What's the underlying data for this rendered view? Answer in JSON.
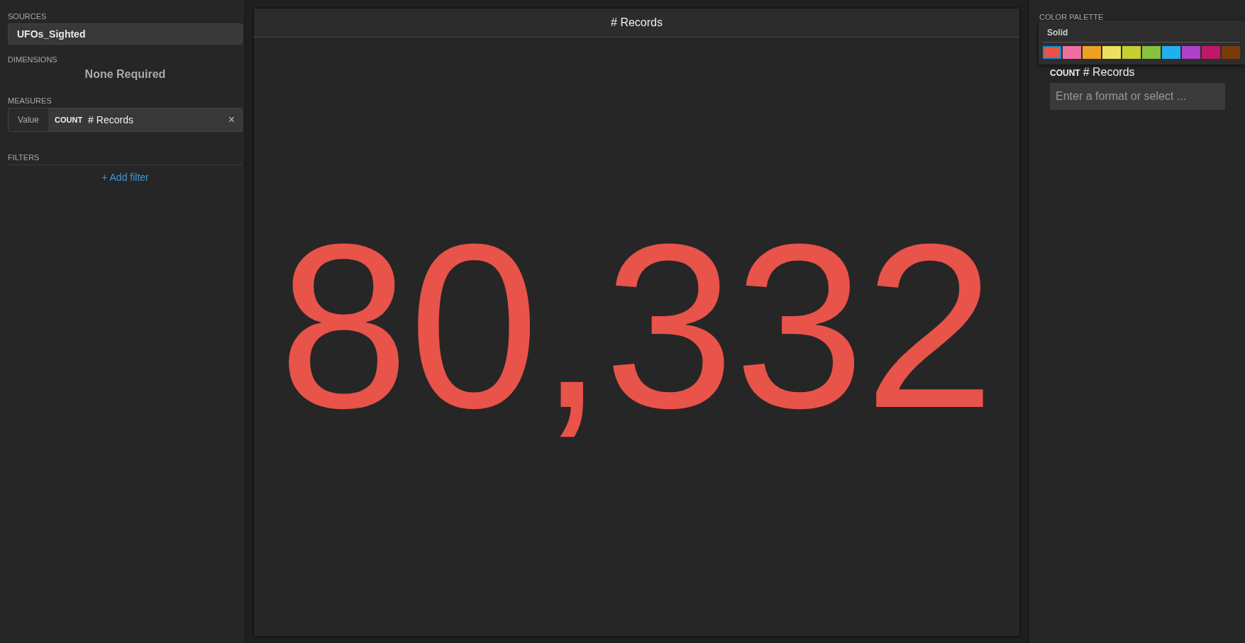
{
  "left_panel": {
    "sources": {
      "label": "SOURCES",
      "value": "UFOs_Sighted"
    },
    "dimensions": {
      "label": "DIMENSIONS",
      "empty_text": "None Required"
    },
    "measures": {
      "label": "MEASURES",
      "items": [
        {
          "role": "Value",
          "aggregate": "COUNT",
          "field": "# Records",
          "remove": "×"
        }
      ]
    },
    "filters": {
      "label": "FILTERS",
      "add": "+ Add filter"
    }
  },
  "chart": {
    "title": "# Records",
    "value": "80,332",
    "color": "#e8534a"
  },
  "right_panel": {
    "color_palette": {
      "label": "COLOR PALETTE",
      "group": "Solid",
      "swatches": [
        {
          "color": "#e8534a",
          "selected": true
        },
        {
          "color": "#f06fa0",
          "selected": false
        },
        {
          "color": "#f0a020",
          "selected": false
        },
        {
          "color": "#ece060",
          "selected": false
        },
        {
          "color": "#c5d030",
          "selected": false
        },
        {
          "color": "#88c040",
          "selected": false
        },
        {
          "color": "#20b0f0",
          "selected": false
        },
        {
          "color": "#b040c8",
          "selected": false
        },
        {
          "color": "#c01868",
          "selected": false
        },
        {
          "color": "#7a3a08",
          "selected": false
        }
      ]
    },
    "formatting": {
      "aggregate": "COUNT",
      "field": "# Records",
      "placeholder": "Enter a format or select ..."
    }
  }
}
